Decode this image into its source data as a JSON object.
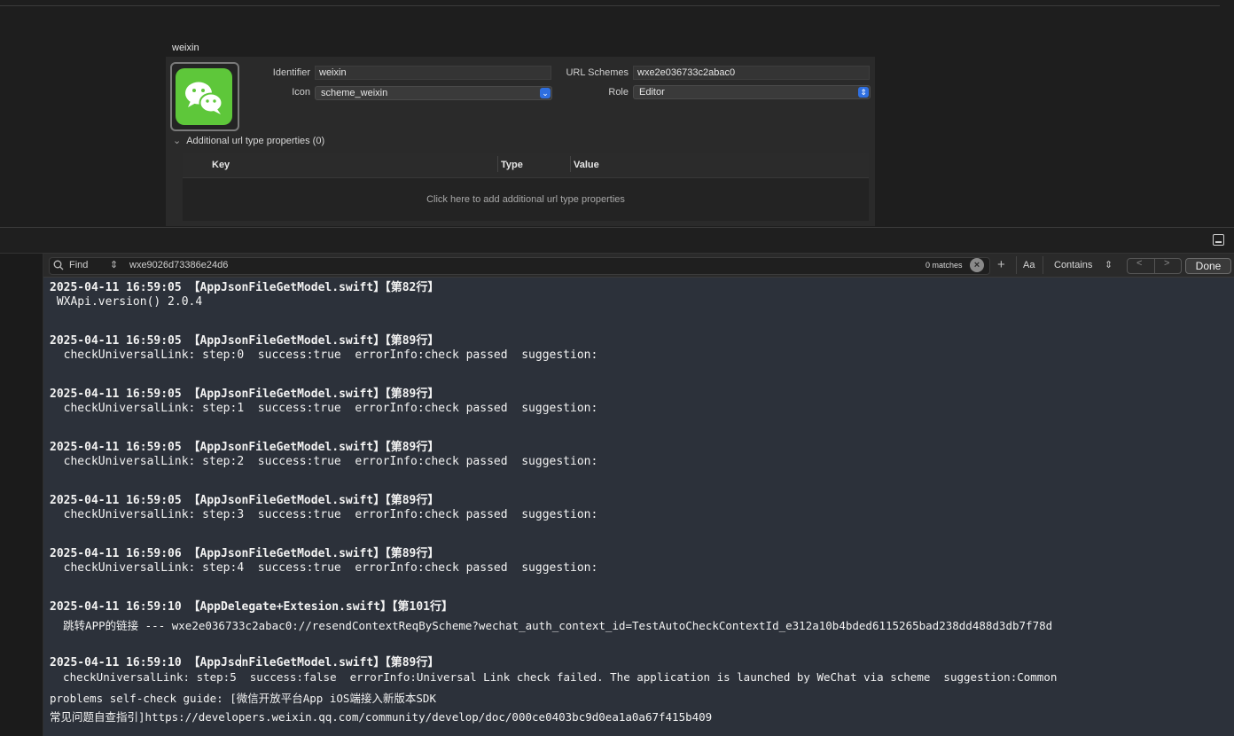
{
  "url_type": {
    "section_title": "weixin",
    "identifier_label": "Identifier",
    "identifier_value": "weixin",
    "icon_label": "Icon",
    "icon_value": "scheme_weixin",
    "url_schemes_label": "URL Schemes",
    "url_schemes_value": "wxe2e036733c2abac0",
    "role_label": "Role",
    "role_value": "Editor",
    "additional_label": "Additional url type properties (0)",
    "columns": [
      "Key",
      "Type",
      "Value"
    ],
    "table_hint": "Click here to add additional url type properties",
    "brand_color": "#5ec73a"
  },
  "find_bar": {
    "mode_label": "Find",
    "query": "wxe9026d73386e24d6",
    "matches": "0 matches",
    "case_toggle": "Aa",
    "match_mode": "Contains",
    "done_label": "Done"
  },
  "console": {
    "lines": [
      "2025-04-11 16:59:05 【AppJsonFileGetModel.swift】【第82行】",
      " WXApi.version() 2.0.4",
      "2025-04-11 16:59:05 【AppJsonFileGetModel.swift】【第89行】",
      "  checkUniversalLink: step:0  success:true  errorInfo:check passed  suggestion:",
      "2025-04-11 16:59:05 【AppJsonFileGetModel.swift】【第89行】",
      "  checkUniversalLink: step:1  success:true  errorInfo:check passed  suggestion:",
      "2025-04-11 16:59:05 【AppJsonFileGetModel.swift】【第89行】",
      "  checkUniversalLink: step:2  success:true  errorInfo:check passed  suggestion:",
      "2025-04-11 16:59:05 【AppJsonFileGetModel.swift】【第89行】",
      "  checkUniversalLink: step:3  success:true  errorInfo:check passed  suggestion:",
      "2025-04-11 16:59:06 【AppJsonFileGetModel.swift】【第89行】",
      "  checkUniversalLink: step:4  success:true  errorInfo:check passed  suggestion:",
      "2025-04-11 16:59:10 【AppDelegate+Extesion.swift】【第101行】",
      "  跳转APP的链接 --- wxe2e036733c2abac0://resendContextReqByScheme?wechat_auth_context_id=TestAutoCheckContextId_e312a10b4bded6115265bad238dd488d3db7f78d",
      "2025-04-11 16:59:10 【AppJsonFileGetModel.swift】【第89行】",
      "  checkUniversalLink: step:5  success:false  errorInfo:Universal Link check failed. The application is launched by WeChat via scheme  suggestion:Common",
      "problems self-check guide: [微信开放平台App iOS端接入新版本SDK",
      "常见问题自查指引]https://developers.weixin.qq.com/community/develop/doc/000ce0403bc9d0ea1a0a67f415b409"
    ]
  }
}
